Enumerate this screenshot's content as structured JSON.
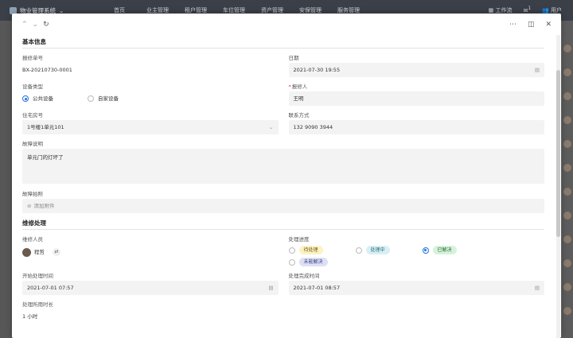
{
  "topbar": {
    "app_title": "物业管理系统",
    "nav": [
      "首页",
      "业主管理",
      "租户管理",
      "车位管理",
      "资产管理",
      "安保管理",
      "服务管理"
    ],
    "workbench": "工作流",
    "notifications_badge": "1",
    "user": "用户"
  },
  "modal": {
    "section_basic": "基本信息",
    "repair_no_label": "报修单号",
    "repair_no": "BX-20210730-0001",
    "date_label": "日期",
    "date": "2021-07-30 19:55",
    "device_type_label": "设备类型",
    "device_type_options": [
      "公共设备",
      "自家设备"
    ],
    "device_type_selected": "公共设备",
    "reporter_label": "报修人",
    "reporter": "王明",
    "room_label": "住宅房号",
    "room": "1号楼1单元101",
    "contact_label": "联系方式",
    "contact": "132 9090 3944",
    "fault_desc_label": "故障说明",
    "fault_desc": "单元门的灯坏了",
    "fault_photo_label": "故障拍照",
    "add_attachment": "添加附件",
    "section_repair": "维修处理",
    "repairer_label": "维修人员",
    "repairer": "程哲",
    "progress_label": "处理进度",
    "progress_options": [
      {
        "label": "待处理",
        "bg": "#fdf2c4",
        "color": "#6b5a1a"
      },
      {
        "label": "处理中",
        "bg": "#d8f0f4",
        "color": "#2a6a76"
      },
      {
        "label": "已解决",
        "bg": "#d7f2dc",
        "color": "#2a6a38"
      },
      {
        "label": "未能解决",
        "bg": "#dde0f5",
        "color": "#3a4080"
      }
    ],
    "progress_selected": "已解决",
    "start_time_label": "开始处理时间",
    "start_time": "2021-07-01 07:57",
    "end_time_label": "处理完成时间",
    "end_time": "2021-07-01 08:57",
    "duration_label": "处理所用时长",
    "duration": "1 小时"
  }
}
